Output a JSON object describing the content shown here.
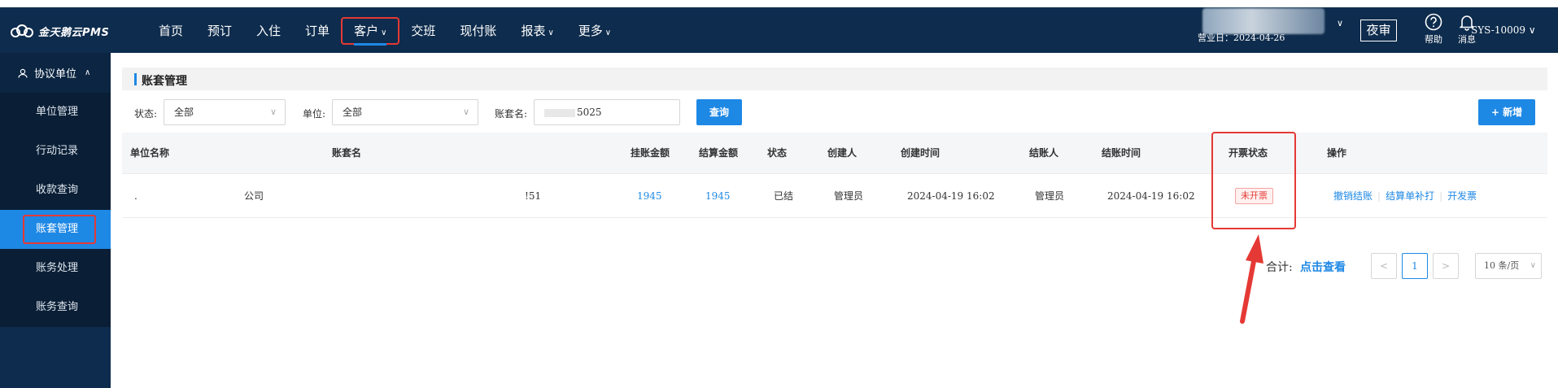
{
  "app": {
    "logo_text": "金天鹅云PMS",
    "logo_icon": "cloud-logo-icon"
  },
  "nav": {
    "items": [
      {
        "label": "首页",
        "dropdown": false
      },
      {
        "label": "预订",
        "dropdown": false
      },
      {
        "label": "入住",
        "dropdown": false
      },
      {
        "label": "订单",
        "dropdown": false
      },
      {
        "label": "客户",
        "dropdown": true,
        "active": true
      },
      {
        "label": "交班",
        "dropdown": false
      },
      {
        "label": "现付账",
        "dropdown": false
      },
      {
        "label": "报表",
        "dropdown": true
      },
      {
        "label": "更多",
        "dropdown": true
      }
    ],
    "chevron": "∨"
  },
  "header": {
    "business_date": "营业日：2024-04-26",
    "night_audit": "夜审",
    "help": "帮助",
    "messages": "消息",
    "user": "SYS-10009 ∨",
    "chevron": "∨"
  },
  "sidebar": {
    "group": "协议单位",
    "items": [
      {
        "label": "单位管理"
      },
      {
        "label": "行动记录"
      },
      {
        "label": "收款查询"
      },
      {
        "label": "账套管理",
        "active": true
      },
      {
        "label": "账务处理"
      },
      {
        "label": "账务查询"
      }
    ]
  },
  "page": {
    "title": "账套管理"
  },
  "filters": {
    "status_label": "状态:",
    "status_value": "全部",
    "unit_label": "单位:",
    "unit_value": "全部",
    "name_label": "账套名:",
    "name_value": "5025",
    "query_button": "查询",
    "add_button": "+ 新增"
  },
  "table": {
    "headers": {
      "unit": "单位名称",
      "name": "账套名",
      "hang": "挂账金额",
      "settle": "结算金额",
      "status": "状态",
      "creator": "创建人",
      "created": "创建时间",
      "settler": "结账人",
      "settled": "结账时间",
      "invoice": "开票状态",
      "ops": "操作"
    },
    "rows": [
      {
        "unit_a": ".",
        "unit_b": "公司",
        "name": "!51",
        "hang": "1945",
        "settle": "1945",
        "status": "已结",
        "creator": "管理员",
        "created": "2024-04-19 16:02",
        "settler": "管理员",
        "settled": "2024-04-19 16:02",
        "invoice": "未开票",
        "ops": [
          "撤销结账",
          "结算单补打",
          "开发票"
        ]
      }
    ]
  },
  "pager": {
    "total_label": "合计:",
    "total_link": "点击查看",
    "prev": "<",
    "next": ">",
    "current": "1",
    "page_size": "10 条/页"
  },
  "colors": {
    "nav_bg": "#0e2c4d",
    "accent": "#1e88e5",
    "highlight": "#e53935"
  }
}
